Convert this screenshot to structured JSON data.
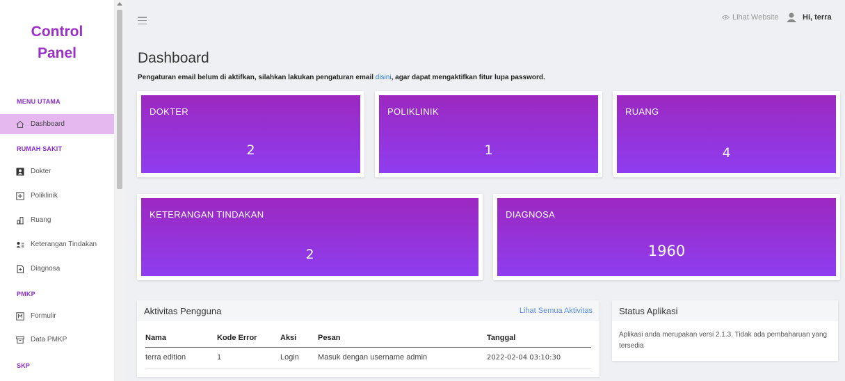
{
  "sidebar": {
    "brand_line1": "Control",
    "brand_line2": "Panel",
    "sections": {
      "menu_utama": "MENU UTAMA",
      "rumah_sakit": "RUMAH SAKIT",
      "pmkp": "PMKP",
      "skp": "SKP"
    },
    "items": {
      "dashboard": "Dashboard",
      "dokter": "Dokter",
      "poliklinik": "Poliklinik",
      "ruang": "Ruang",
      "keterangan": "Keterangan Tindakan",
      "diagnosa": "Diagnosa",
      "formulir": "Formulir",
      "data_pmkp": "Data PMKP"
    }
  },
  "topbar": {
    "website_link": "Lihat Website",
    "user_greeting": "Hi, terra"
  },
  "main": {
    "title": "Dashboard",
    "notice_before": "Pengaturan email belum di aktifkan, silahkan lakukan pengaturan email ",
    "notice_link": "disini",
    "notice_after": ", agar dapat mengaktifkan fitur lupa password."
  },
  "stats": {
    "dokter": {
      "label": "DOKTER",
      "value": "2"
    },
    "poliklinik": {
      "label": "POLIKLINIK",
      "value": "1"
    },
    "ruang": {
      "label": "RUANG",
      "value": "4"
    },
    "keterangan": {
      "label": "KETERANGAN TINDAKAN",
      "value": "2"
    },
    "diagnosa": {
      "label": "DIAGNOSA",
      "value": "1960"
    }
  },
  "activity": {
    "title": "Aktivitas Pengguna",
    "view_all": "Lihat Semua Aktivitas",
    "columns": {
      "nama": "Nama",
      "kode": "Kode Error",
      "aksi": "Aksi",
      "pesan": "Pesan",
      "tanggal": "Tanggal"
    },
    "rows": [
      {
        "nama": "terra edition",
        "kode": "1",
        "aksi": "Login",
        "pesan": "Masuk dengan username admin",
        "tanggal": "2022-02-04 03:10:30"
      }
    ]
  },
  "status": {
    "title": "Status Aplikasi",
    "message": "Aplikasi anda merupakan versi 2.1.3. Tidak ada pembaharuan yang tersedia"
  },
  "colors": {
    "accent": "#9b30c9",
    "card_gradient_top": "#9c28c0",
    "card_gradient_bottom": "#8e3df0",
    "active_nav": "#e6b8f0",
    "link": "#2c7be5"
  }
}
